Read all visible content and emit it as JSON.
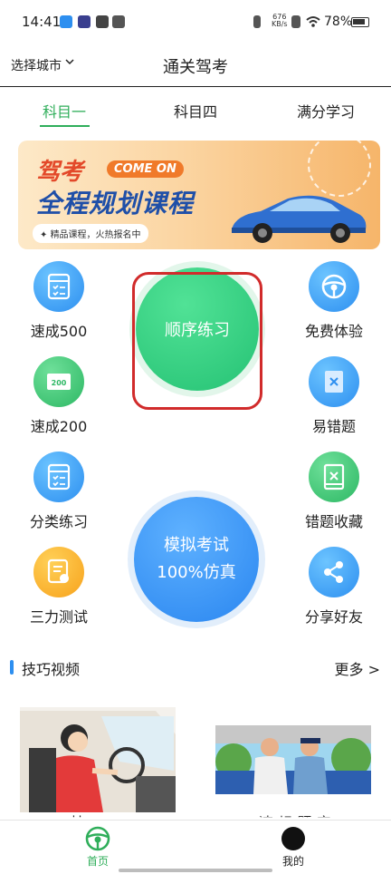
{
  "status_bar": {
    "time": "14:41",
    "net_speed": "676",
    "net_unit": "KB/s",
    "battery": "78%"
  },
  "header": {
    "city_select": "选择城市",
    "title": "通关驾考"
  },
  "tabs": [
    {
      "label": "科目一",
      "active": true
    },
    {
      "label": "科目四",
      "active": false
    },
    {
      "label": "满分学习",
      "active": false
    }
  ],
  "banner": {
    "line1": "驾考",
    "badge": "COME ON",
    "line2": "全程规划课程",
    "tag": "精品课程，火热报名中"
  },
  "grid": {
    "left": [
      {
        "label": "速成500",
        "icon": "checklist-icon",
        "color": "blue"
      },
      {
        "label": "速成200",
        "icon": "card-200-icon",
        "color": "green"
      },
      {
        "label": "分类练习",
        "icon": "checklist-icon",
        "color": "blue"
      },
      {
        "label": "三力测试",
        "icon": "certificate-icon",
        "color": "orange"
      }
    ],
    "right": [
      {
        "label": "免费体验",
        "icon": "steering-wheel-icon",
        "color": "blue"
      },
      {
        "label": "易错题",
        "icon": "error-card-icon",
        "color": "blue"
      },
      {
        "label": "错题收藏",
        "icon": "collection-icon",
        "color": "green"
      },
      {
        "label": "分享好友",
        "icon": "share-icon",
        "color": "blue"
      }
    ]
  },
  "sequential_practice": "顺序练习",
  "mock_exam": {
    "line1": "模拟考试",
    "line2": "100%仿真"
  },
  "videos": {
    "title": "技巧视频",
    "more": "更多 >",
    "item1_partial": "挂二",
    "item2_partial": "违 规 题 库"
  },
  "bottom_nav": [
    {
      "label": "首页",
      "active": true
    },
    {
      "label": "我的",
      "active": false
    }
  ],
  "colors": {
    "accent_green": "#2fae5a",
    "blue": "#2d8ff0",
    "highlight_red": "#d12b2b"
  }
}
